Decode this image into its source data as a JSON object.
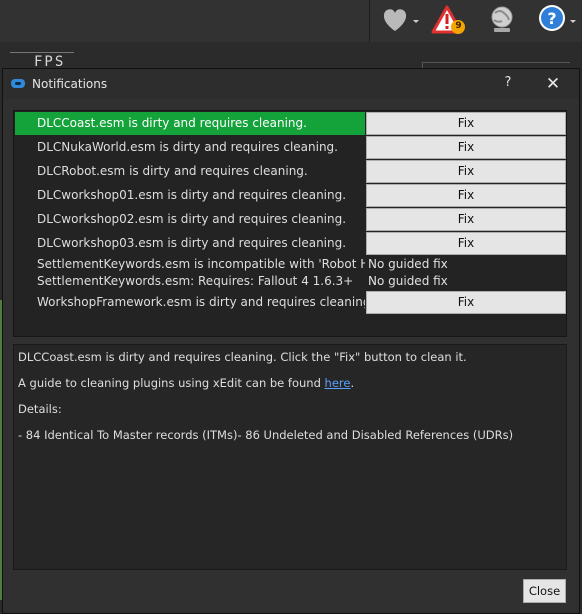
{
  "background": {
    "fps_text": "FPS",
    "badge_count": "9"
  },
  "dialog": {
    "title": "Notifications",
    "help_label": "?",
    "close_glyph": "✕",
    "rows": [
      {
        "message": "DLCCoast.esm is dirty and requires cleaning.",
        "action": "Fix",
        "selected": true
      },
      {
        "message": "DLCNukaWorld.esm is dirty and requires cleaning.",
        "action": "Fix"
      },
      {
        "message": "DLCRobot.esm is dirty and requires cleaning.",
        "action": "Fix"
      },
      {
        "message": "DLCworkshop01.esm is dirty and requires cleaning.",
        "action": "Fix"
      },
      {
        "message": "DLCworkshop02.esm is dirty and requires cleaning.",
        "action": "Fix"
      },
      {
        "message": "DLCworkshop03.esm is dirty and requires cleaning.",
        "action": "Fix"
      },
      {
        "message": "SettlementKeywords.esm is incompatible with 'Robot Hom...",
        "action": "No guided fix"
      },
      {
        "message": "SettlementKeywords.esm: Requires: Fallout 4 1.6.3+",
        "action": "No guided fix"
      },
      {
        "message": "WorkshopFramework.esm is dirty and requires cleaning.",
        "action": "Fix"
      }
    ],
    "details": {
      "line1": "DLCCoast.esm is dirty and requires cleaning. Click the \"Fix\" button to clean it.",
      "line2_prefix": "A guide to cleaning plugins using xEdit can be found ",
      "line2_link": "here",
      "line2_suffix": ".",
      "line3": "Details:",
      "line4": "- 84 Identical To Master records (ITMs)- 86 Undeleted and Disabled References (UDRs)"
    },
    "close_label": "Close"
  },
  "colors": {
    "selected_row": "#14a33a",
    "link": "#5aa0ff",
    "warning_red": "#e03030",
    "badge_orange": "#f5a500",
    "help_blue": "#2f7fd8"
  }
}
